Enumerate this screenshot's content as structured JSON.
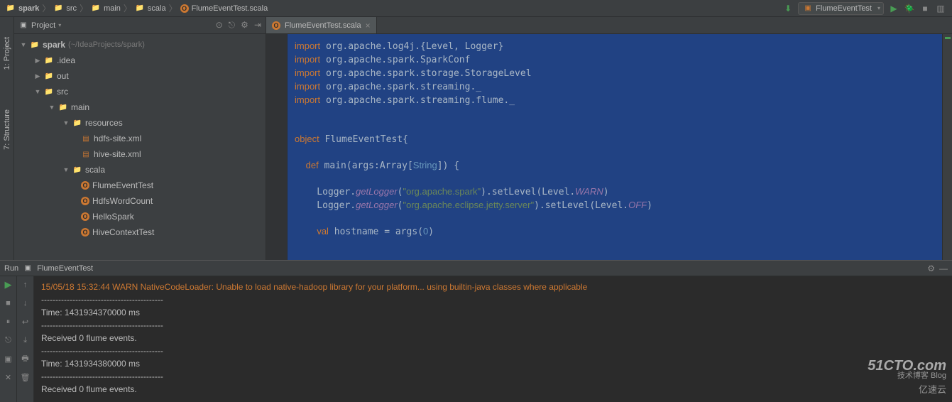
{
  "breadcrumbs": [
    {
      "icon": "folder",
      "label": "spark",
      "bold": true
    },
    {
      "icon": "folder-blue",
      "label": "src"
    },
    {
      "icon": "folder-blue",
      "label": "main"
    },
    {
      "icon": "folder-blue",
      "label": "scala"
    },
    {
      "icon": "scala-o",
      "label": "FlumeEventTest.scala"
    }
  ],
  "run_config": {
    "label": "FlumeEventTest"
  },
  "left_tabs": {
    "project": "1: Project",
    "structure": "7: Structure"
  },
  "project_panel": {
    "title": "Project",
    "tree": {
      "root": {
        "label": "spark",
        "path": "(~/IdeaProjects/spark)"
      },
      "idea": ".idea",
      "out": "out",
      "src": "src",
      "main": "main",
      "resources": "resources",
      "hdfs": "hdfs-site.xml",
      "hive": "hive-site.xml",
      "scala": "scala",
      "files": [
        "FlumeEventTest",
        "HdfsWordCount",
        "HelloSpark",
        "HiveContextTest"
      ]
    }
  },
  "editor": {
    "tab_label": "FlumeEventTest.scala",
    "code": {
      "l1": "import org.apache.log4j.{Level, Logger}",
      "l2": "import org.apache.spark.SparkConf",
      "l3": "import org.apache.spark.storage.StorageLevel",
      "l4": "import org.apache.spark.streaming._",
      "l5": "import org.apache.spark.streaming.flume._",
      "l6": "object FlumeEventTest{",
      "l7": "  def main(args:Array[String]) {",
      "l8": "    Logger.getLogger(\"org.apache.spark\").setLevel(Level.WARN)",
      "l9": "    Logger.getLogger(\"org.apache.eclipse.jetty.server\").setLevel(Level.OFF)",
      "l10": "    val hostname = args(0)"
    }
  },
  "run": {
    "label": "Run",
    "config": "FlumeEventTest",
    "console": [
      {
        "cls": "warn",
        "text": "15/05/18 15:32:44 WARN NativeCodeLoader: Unable to load native-hadoop library for your platform... using builtin-java classes where applicable"
      },
      {
        "cls": "",
        "text": "-------------------------------------------"
      },
      {
        "cls": "",
        "text": "Time: 1431934370000 ms"
      },
      {
        "cls": "",
        "text": "-------------------------------------------"
      },
      {
        "cls": "",
        "text": "Received 0 flume events."
      },
      {
        "cls": "",
        "text": ""
      },
      {
        "cls": "",
        "text": "-------------------------------------------"
      },
      {
        "cls": "",
        "text": "Time: 1431934380000 ms"
      },
      {
        "cls": "",
        "text": "-------------------------------------------"
      },
      {
        "cls": "",
        "text": "Received 0 flume events."
      }
    ]
  },
  "watermark": {
    "line1": "51CTO.com",
    "line2": "技术博客  Blog",
    "line3": "亿速云"
  }
}
